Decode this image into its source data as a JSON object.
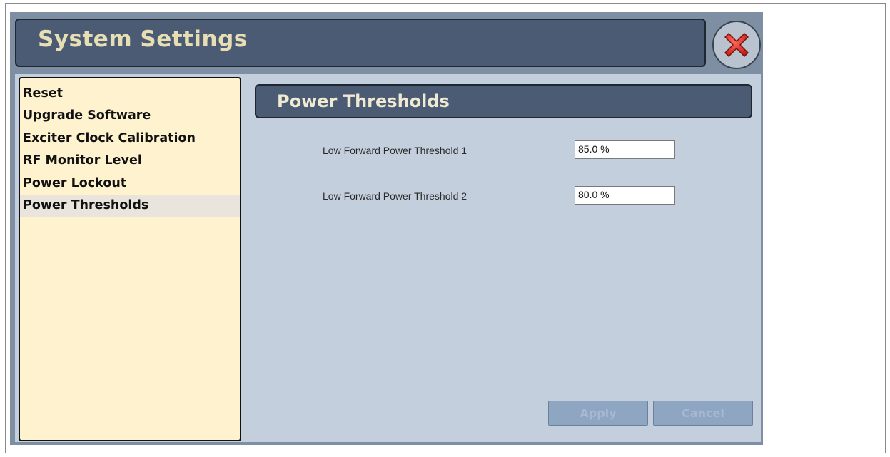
{
  "window": {
    "title": "System Settings"
  },
  "icons": {
    "close": "close-icon"
  },
  "colors": {
    "title_bar": "#4a5b73",
    "title_text": "#e8deb4",
    "menu_background": "#fff3cf",
    "content_background": "#c4cfdd",
    "close_icon_red": "#d8302a"
  },
  "sidebar": {
    "items": [
      {
        "label": "Reset",
        "selected": false
      },
      {
        "label": "Upgrade Software",
        "selected": false
      },
      {
        "label": "Exciter Clock Calibration",
        "selected": false
      },
      {
        "label": "RF Monitor Level",
        "selected": false
      },
      {
        "label": "Power Lockout",
        "selected": false
      },
      {
        "label": "Power Thresholds",
        "selected": true
      }
    ]
  },
  "main": {
    "section_title": "Power Thresholds",
    "fields": [
      {
        "label": "Low Forward Power Threshold 1",
        "value": "85.0 %"
      },
      {
        "label": "Low Forward Power Threshold 2",
        "value": "80.0 %"
      }
    ],
    "buttons": {
      "apply": "Apply",
      "cancel": "Cancel"
    }
  }
}
